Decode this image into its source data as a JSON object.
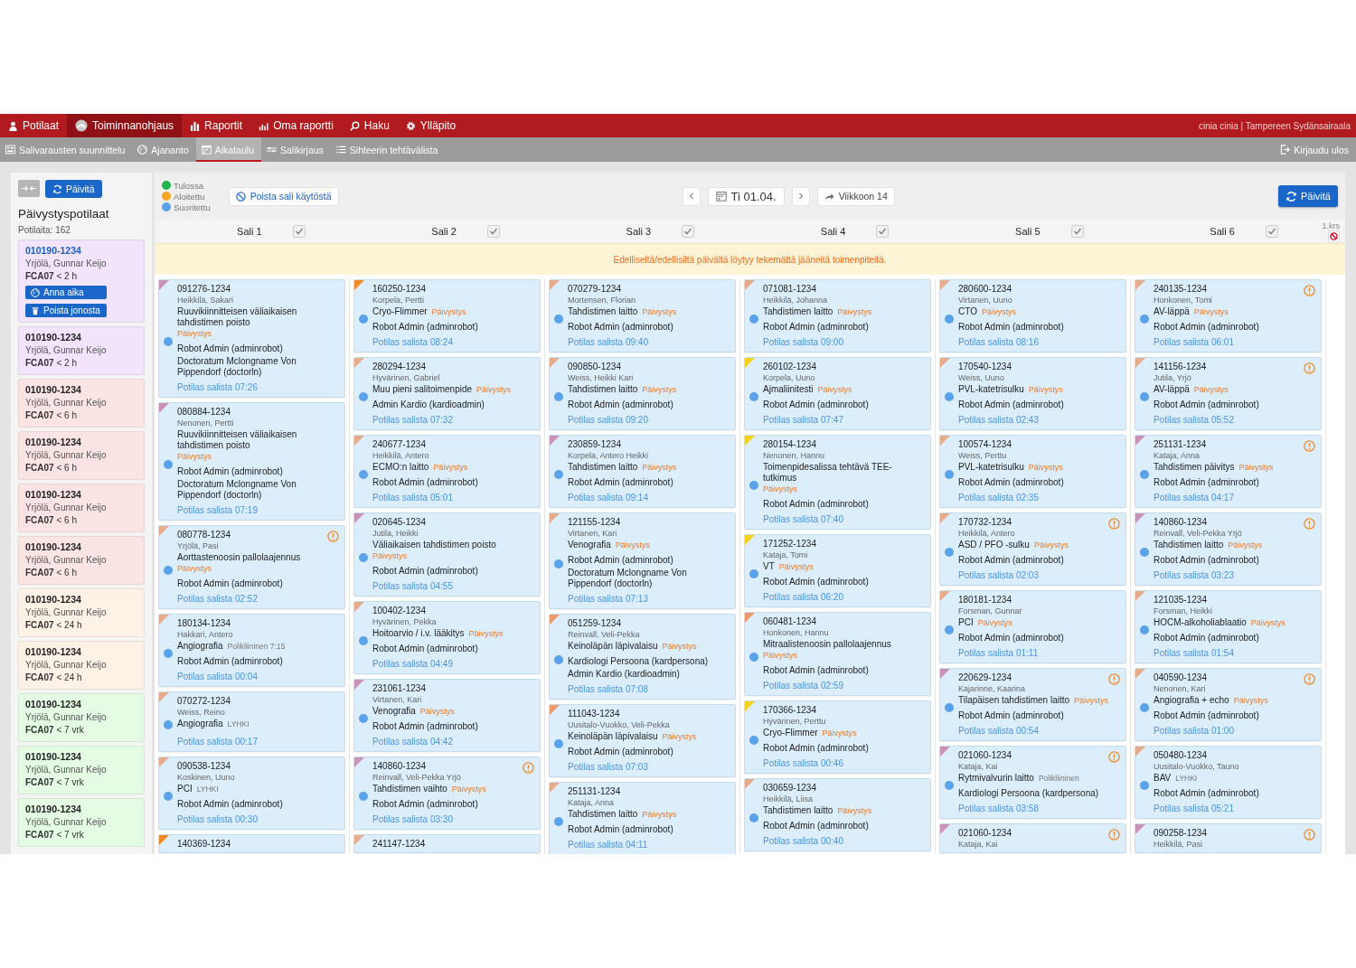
{
  "nav": {
    "items": [
      {
        "label": "Potilaat",
        "selected": false
      },
      {
        "label": "Toiminnanohjaus",
        "selected": true
      },
      {
        "label": "Raportit",
        "selected": false
      },
      {
        "label": "Oma raportti",
        "selected": false
      },
      {
        "label": "Haku",
        "selected": false
      },
      {
        "label": "Ylläpito",
        "selected": false
      }
    ],
    "user": "cinia cinia | Tampereen Sydänsairaala"
  },
  "subnav": {
    "items": [
      {
        "label": "Salivarausten suunnittelu",
        "selected": false
      },
      {
        "label": "Ajananto",
        "selected": false
      },
      {
        "label": "Aikataulu",
        "selected": true
      },
      {
        "label": "Salikirjaus",
        "selected": false
      },
      {
        "label": "Sihteerin tehtävälista",
        "selected": false
      }
    ],
    "logout": "Kirjaudu ulos"
  },
  "sidebar": {
    "refresh": "Päivitä",
    "title": "Päivystyspotilaat",
    "count": "Potilaita: 162",
    "patients": [
      {
        "id": "010190-1234",
        "name": "Yrjölä, Gunnar Keijo",
        "urgency": "**FCA07** < 2 h",
        "color": "#f1e4fc",
        "selected": true,
        "actions": [
          {
            "label": "Anna aika",
            "kind": "schedule"
          },
          {
            "label": "Poista jonosta",
            "kind": "remove"
          }
        ]
      },
      {
        "id": "010190-1234",
        "name": "Yrjölä, Gunnar Keijo",
        "urgency": "**FCA07** < 2 h",
        "color": "#f1e4fc",
        "selected": false
      },
      {
        "id": "010190-1234",
        "name": "Yrjölä, Gunnar Keijo",
        "urgency": "**FCA07** < 6 h",
        "color": "#fde4e4",
        "selected": false
      },
      {
        "id": "010190-1234",
        "name": "Yrjölä, Gunnar Keijo",
        "urgency": "**FCA07** < 6 h",
        "color": "#fde4e4",
        "selected": false
      },
      {
        "id": "010190-1234",
        "name": "Yrjölä, Gunnar Keijo",
        "urgency": "**FCA07** < 6 h",
        "color": "#fde4e4",
        "selected": false
      },
      {
        "id": "010190-1234",
        "name": "Yrjölä, Gunnar Keijo",
        "urgency": "**FCA07** < 6 h",
        "color": "#fde4e4",
        "selected": false
      },
      {
        "id": "010190-1234",
        "name": "Yrjölä, Gunnar Keijo",
        "urgency": "**FCA07** < 24 h",
        "color": "#fef1e6",
        "selected": false
      },
      {
        "id": "010190-1234",
        "name": "Yrjölä, Gunnar Keijo",
        "urgency": "**FCA07** < 24 h",
        "color": "#fef1e6",
        "selected": false
      },
      {
        "id": "010190-1234",
        "name": "Yrjölä, Gunnar Keijo",
        "urgency": "**FCA07** < 7 vrk",
        "color": "#e4fbe4",
        "selected": false
      },
      {
        "id": "010190-1234",
        "name": "Yrjölä, Gunnar Keijo",
        "urgency": "**FCA07** < 7 vrk",
        "color": "#e4fbe4",
        "selected": false
      },
      {
        "id": "010190-1234",
        "name": "Yrjölä, Gunnar Keijo",
        "urgency": "**FCA07** < 7 vrk",
        "color": "#e4fbe4",
        "selected": false
      }
    ]
  },
  "toolbar": {
    "legend": [
      {
        "label": "Tulossa",
        "color": "#22b14c"
      },
      {
        "label": "Aloitettu",
        "color": "#f5a623"
      },
      {
        "label": "Suoritettu",
        "color": "#5aa2ea"
      }
    ],
    "disable_room": "Poista sali käytöstä",
    "date": "Ti 01.04.",
    "week": "Viikkoon 14",
    "refresh": "Päivitä"
  },
  "rooms": [
    {
      "name": "Sali 1",
      "checked": true
    },
    {
      "name": "Sali 2",
      "checked": true
    },
    {
      "name": "Sali 3",
      "checked": true
    },
    {
      "name": "Sali 4",
      "checked": true
    },
    {
      "name": "Sali 5",
      "checked": true
    },
    {
      "name": "Sali 6",
      "checked": true
    }
  ],
  "floor": "1.krs",
  "notice": "Edelliseltä/edellisiltä päivältä löytyy tekemättä jääneitä toimenpiteitä.",
  "columns": [
    {
      "cards": [
        {
          "id": "091276-1234",
          "name": "Heikkilä, Sakari",
          "procedure": "Ruuvikiinnitteisen väliaikaisen tahdistimen poisto",
          "tag": {
            "text": "Päivystys",
            "kind": "urgent"
          },
          "staff": [
            "Robot Admin (adminrobot)",
            "Doctoratum Mclongname Von Pippendorf (doctorln)"
          ],
          "time": "Potilas salista 07:26",
          "color": "#c993b8",
          "warning": false
        },
        {
          "id": "080884-1234",
          "name": "Nenonen, Pertti",
          "procedure": "Ruuvikiinnitteisen väliaikaisen tahdistimen poisto",
          "tag": {
            "text": "Päivystys",
            "kind": "urgent"
          },
          "staff": [
            "Robot Admin (adminrobot)",
            "Doctoratum Mclongname Von Pippendorf (doctorln)"
          ],
          "time": "Potilas salista 07:19",
          "color": "#c993b8",
          "warning": false
        },
        {
          "id": "080778-1234",
          "name": "Yrjölä, Pasi",
          "procedure": "Aorttastenoosin pallolaajennus",
          "tag": {
            "text": "Päivystys",
            "kind": "urgent"
          },
          "staff": [
            "Robot Admin (adminrobot)"
          ],
          "time": "Potilas salista 02:52",
          "color": "#e6ad8c",
          "warning": true
        },
        {
          "id": "180134-1234",
          "name": "Hakkari, Antero",
          "procedure": "Angiografia",
          "tag": {
            "text": "Polikliininen 7:15",
            "kind": "plain"
          },
          "staff": [
            "Robot Admin (adminrobot)"
          ],
          "time": "Potilas salista 00:04",
          "color": "#e6ad8c",
          "warning": false
        },
        {
          "id": "070272-1234",
          "name": "Weiss, Reino",
          "procedure": "Angiografia",
          "tag": {
            "text": "LYHKI",
            "kind": "plain"
          },
          "time": "Potilas salista 00:17",
          "color": "#e6ad8c",
          "warning": false
        },
        {
          "id": "090538-1234",
          "name": "Koskinen, Uuno",
          "procedure": "PCI",
          "tag": {
            "text": "LYHKI",
            "kind": "plain"
          },
          "staff": [
            "Robot Admin (adminrobot)"
          ],
          "time": "Potilas salista 00:30",
          "color": "#e6ad8c",
          "warning": false
        },
        {
          "id": "140369-1234",
          "color": "#f08a24",
          "warning": false
        }
      ]
    },
    {
      "cards": [
        {
          "id": "160250-1234",
          "name": "Korpela, Pertti",
          "procedure": "Cryo-Flimmer",
          "tag": {
            "text": "Päivystys",
            "kind": "urgent"
          },
          "staff": [
            "Robot Admin (adminrobot)"
          ],
          "time": "Potilas salista 08:24",
          "color": "#f08a24",
          "warning": false
        },
        {
          "id": "280294-1234",
          "name": "Hyvärinen, Gabriel",
          "procedure": "Muu pieni salitoimenpide",
          "tag": {
            "text": "Päivystys",
            "kind": "urgent"
          },
          "staff": [
            "Admin Kardio (kardioadmin)"
          ],
          "time": "Potilas salista 07:32",
          "color": "#e6ad8c",
          "warning": false
        },
        {
          "id": "240677-1234",
          "name": "Heikkilä, Antero",
          "procedure": "ECMO:n laitto",
          "tag": {
            "text": "Päivystys",
            "kind": "urgent"
          },
          "staff": [
            "Robot Admin (adminrobot)"
          ],
          "time": "Potilas salista 05:01",
          "color": "#e6ad8c",
          "warning": false
        },
        {
          "id": "020645-1234",
          "name": "Jutila, Heikki",
          "procedure": "Väliaikaisen tahdistimen poisto",
          "tag": {
            "text": "Päivystys",
            "kind": "urgent"
          },
          "staff": [
            "Robot Admin (adminrobot)"
          ],
          "time": "Potilas salista 04:55",
          "color": "#c993b8",
          "warning": false
        },
        {
          "id": "100402-1234",
          "name": "Hyvärinen, Pekka",
          "procedure": "Hoitoarvio / i.v. lääkitys",
          "tag": {
            "text": "Päivystys",
            "kind": "urgent"
          },
          "staff": [
            "Robot Admin (adminrobot)"
          ],
          "time": "Potilas salista 04:49",
          "color": "#e6ad8c",
          "warning": false
        },
        {
          "id": "231061-1234",
          "name": "Virtanen, Kari",
          "procedure": "Venografia",
          "tag": {
            "text": "Päivystys",
            "kind": "urgent"
          },
          "staff": [
            "Robot Admin (adminrobot)"
          ],
          "time": "Potilas salista 04:42",
          "color": "#c993b8",
          "warning": false
        },
        {
          "id": "140860-1234",
          "name": "Reinvall, Veli-Pekka Yrjö",
          "procedure": "Tahdistimen vaihto",
          "tag": {
            "text": "Päivystys",
            "kind": "urgent"
          },
          "staff": [
            "Robot Admin (adminrobot)"
          ],
          "time": "Potilas salista 03:30",
          "color": "#c993b8",
          "warning": true
        },
        {
          "id": "241147-1234",
          "color": "#e6ad8c",
          "warning": false
        }
      ]
    },
    {
      "cards": [
        {
          "id": "070279-1234",
          "name": "Mortensen, Florian",
          "procedure": "Tahdistimen laitto",
          "tag": {
            "text": "Päivystys",
            "kind": "urgent"
          },
          "staff": [
            "Robot Admin (adminrobot)"
          ],
          "time": "Potilas salista 09:40",
          "color": "#e6ad8c",
          "warning": false
        },
        {
          "id": "090850-1234",
          "name": "Weiss, Heikki Kari",
          "procedure": "Tahdistimen laitto",
          "tag": {
            "text": "Päivystys",
            "kind": "urgent"
          },
          "staff": [
            "Robot Admin (adminrobot)"
          ],
          "time": "Potilas salista 09:20",
          "color": "#e6ad8c",
          "warning": false
        },
        {
          "id": "230859-1234",
          "name": "Korpela, Antero Heikki",
          "procedure": "Tahdistimen laitto",
          "tag": {
            "text": "Päivystys",
            "kind": "urgent"
          },
          "staff": [
            "Robot Admin (adminrobot)"
          ],
          "time": "Potilas salista 09:14",
          "color": "#c993b8",
          "warning": false
        },
        {
          "id": "121155-1234",
          "name": "Virtanen, Kari",
          "procedure": "Venografia",
          "tag": {
            "text": "Päivystys",
            "kind": "urgent"
          },
          "staff": [
            "Robot Admin (adminrobot)",
            "Doctoratum Mclongname Von Pippendorf (doctorln)"
          ],
          "time": "Potilas salista 07:13",
          "color": "#e6ad8c",
          "warning": false
        },
        {
          "id": "051259-1234",
          "name": "Reinvall, Veli-Pekka",
          "procedure": "Keinoläpän läpivalaisu",
          "tag": {
            "text": "Päivystys",
            "kind": "urgent"
          },
          "staff": [
            "Kardiologi Persoona (kardpersona)",
            "Admin Kardio (kardioadmin)"
          ],
          "time": "Potilas salista 07:08",
          "color": "#ec9a6c",
          "warning": false
        },
        {
          "id": "111043-1234",
          "name": "Uusitalo-Vuokko, Veli-Pekka",
          "procedure": "Keinoläpän läpivalaisu",
          "tag": {
            "text": "Päivystys",
            "kind": "urgent"
          },
          "staff": [
            "Robot Admin (adminrobot)"
          ],
          "time": "Potilas salista 07:03",
          "color": "#ec9a6c",
          "warning": false
        },
        {
          "id": "251131-1234",
          "name": "Kataja, Anna",
          "procedure": "Tahdistimen laitto",
          "tag": {
            "text": "Päivystys",
            "kind": "urgent"
          },
          "staff": [
            "Robot Admin (adminrobot)"
          ],
          "time": "Potilas salista 04:11",
          "color": "#e6ad8c",
          "warning": false
        }
      ]
    },
    {
      "cards": [
        {
          "id": "071081-1234",
          "name": "Heikkilä, Johanna",
          "procedure": "Tahdistimen laitto",
          "tag": {
            "text": "Päivystys",
            "kind": "urgent"
          },
          "staff": [
            "Robot Admin (adminrobot)"
          ],
          "time": "Potilas salista 09:00",
          "color": "#e6ad8c",
          "warning": false
        },
        {
          "id": "260102-1234",
          "name": "Korpela, Uuno",
          "procedure": "Ajmaliinitesti",
          "tag": {
            "text": "Päivystys",
            "kind": "urgent"
          },
          "staff": [
            "Robot Admin (adminrobot)"
          ],
          "time": "Potilas salista 07:47",
          "color": "#f3d21c",
          "warning": false
        },
        {
          "id": "280154-1234",
          "name": "Nenonen, Hannu",
          "procedure": "Toimenpidesalissa tehtävä TEE-tutkimus",
          "tag": {
            "text": "Päivystys",
            "kind": "urgent"
          },
          "staff": [
            "Robot Admin (adminrobot)"
          ],
          "time": "Potilas salista 07:40",
          "color": "#f3d21c",
          "warning": false
        },
        {
          "id": "171252-1234",
          "name": "Kataja, Tomi",
          "procedure": "VT",
          "tag": {
            "text": "Päivystys",
            "kind": "urgent"
          },
          "staff": [
            "Robot Admin (adminrobot)"
          ],
          "time": "Potilas salista 06:20",
          "color": "#f3d21c",
          "warning": false
        },
        {
          "id": "060481-1234",
          "name": "Honkonen, Hannu",
          "procedure": "Mitraalistenoosin pallolaajennus",
          "tag": {
            "text": "Päivystys",
            "kind": "urgent"
          },
          "staff": [
            "Robot Admin (adminrobot)"
          ],
          "time": "Potilas salista 02:59",
          "color": "#ec9a6c",
          "warning": false
        },
        {
          "id": "170366-1234",
          "name": "Hyvärinen, Perttu",
          "procedure": "Cryo-Flimmer",
          "tag": {
            "text": "Päivystys",
            "kind": "urgent"
          },
          "staff": [
            "Robot Admin (adminrobot)"
          ],
          "time": "Potilas salista 00:46",
          "color": "#f3d21c",
          "warning": false
        },
        {
          "id": "030659-1234",
          "name": "Heikkilä, Liisa",
          "procedure": "Tahdistimen laitto",
          "tag": {
            "text": "Päivystys",
            "kind": "urgent"
          },
          "staff": [
            "Robot Admin (adminrobot)"
          ],
          "time": "Potilas salista 00:40",
          "color": "#e6ad8c",
          "warning": false
        }
      ]
    },
    {
      "cards": [
        {
          "id": "280600-1234",
          "name": "Virtanen, Uuno",
          "procedure": "CTO",
          "tag": {
            "text": "Päivystys",
            "kind": "urgent"
          },
          "staff": [
            "Robot Admin (adminrobot)"
          ],
          "time": "Potilas salista 08:16",
          "color": "#e6ad8c",
          "warning": false
        },
        {
          "id": "170540-1234",
          "name": "Weiss, Uuno",
          "procedure": "PVL-katetrisulku",
          "tag": {
            "text": "Päivystys",
            "kind": "urgent"
          },
          "staff": [
            "Robot Admin (adminrobot)"
          ],
          "time": "Potilas salista 02:43",
          "color": "#e6ad8c",
          "warning": false
        },
        {
          "id": "100574-1234",
          "name": "Weiss, Perttu",
          "procedure": "PVL-katetrisulku",
          "tag": {
            "text": "Päivystys",
            "kind": "urgent"
          },
          "staff": [
            "Robot Admin (adminrobot)"
          ],
          "time": "Potilas salista 02:35",
          "color": "#e6ad8c",
          "warning": false
        },
        {
          "id": "170732-1234",
          "name": "Heikkilä, Antero",
          "procedure": "ASD / PFO -sulku",
          "tag": {
            "text": "Päivystys",
            "kind": "urgent"
          },
          "staff": [
            "Robot Admin (adminrobot)"
          ],
          "time": "Potilas salista 02:03",
          "color": "#e6ad8c",
          "warning": true
        },
        {
          "id": "180181-1234",
          "name": "Forsman, Gunnar",
          "procedure": "PCI",
          "tag": {
            "text": "Päivystys",
            "kind": "urgent"
          },
          "staff": [
            "Robot Admin (adminrobot)"
          ],
          "time": "Potilas salista 01:11",
          "color": "#e6ad8c",
          "warning": false
        },
        {
          "id": "220629-1234",
          "name": "Kajarinne, Kaarina",
          "procedure": "Tilapäisen tahdistimen laitto",
          "tag": {
            "text": "Päivystys",
            "kind": "urgent"
          },
          "staff": [
            "Robot Admin (adminrobot)"
          ],
          "time": "Potilas salista 00:54",
          "color": "#c993b8",
          "warning": true
        },
        {
          "id": "021060-1234",
          "name": "Kataja, Kai",
          "procedure": "Rytmivalvurin laitto",
          "tag": {
            "text": "Polikliininen",
            "kind": "plain"
          },
          "staff": [
            "Kardiologi Persoona (kardpersona)"
          ],
          "time": "Potilas salista 03:58",
          "color": "#c993b8",
          "warning": true
        },
        {
          "id": "021060-1234",
          "name": "Kataja, Kai",
          "color": "#c993b8",
          "warning": true
        }
      ]
    },
    {
      "cards": [
        {
          "id": "240135-1234",
          "name": "Honkonen, Tomi",
          "procedure": "AV-läppä",
          "tag": {
            "text": "Päivystys",
            "kind": "urgent"
          },
          "staff": [
            "Robot Admin (adminrobot)"
          ],
          "time": "Potilas salista 06:01",
          "color": "#e6ad8c",
          "warning": true
        },
        {
          "id": "141156-1234",
          "name": "Jutila, Yrjö",
          "procedure": "AV-läppä",
          "tag": {
            "text": "Päivystys",
            "kind": "urgent"
          },
          "staff": [
            "Robot Admin (adminrobot)"
          ],
          "time": "Potilas salista 05:52",
          "color": "#e6ad8c",
          "warning": true
        },
        {
          "id": "251131-1234",
          "name": "Kataja, Anna",
          "procedure": "Tahdistimen päivitys",
          "tag": {
            "text": "Päivystys",
            "kind": "urgent"
          },
          "staff": [
            "Robot Admin (adminrobot)"
          ],
          "time": "Potilas salista 04:17",
          "color": "#c993b8",
          "warning": true
        },
        {
          "id": "140860-1234",
          "name": "Reinvall, Veli-Pekka Yrjö",
          "procedure": "Tahdistimen laitto",
          "tag": {
            "text": "Päivystys",
            "kind": "urgent"
          },
          "staff": [
            "Robot Admin (adminrobot)"
          ],
          "time": "Potilas salista 03:23",
          "color": "#c993b8",
          "warning": true
        },
        {
          "id": "121035-1234",
          "name": "Forsman, Heikki",
          "procedure": "HOCM-alkoholiablaatio",
          "tag": {
            "text": "Päivystys",
            "kind": "urgent"
          },
          "staff": [
            "Robot Admin (adminrobot)"
          ],
          "time": "Potilas salista 01:54",
          "color": "#e6ad8c",
          "warning": false
        },
        {
          "id": "040590-1234",
          "name": "Nenonen, Kari",
          "procedure": "Angiografia + echo",
          "tag": {
            "text": "Päivystys",
            "kind": "urgent"
          },
          "staff": [
            "Robot Admin (adminrobot)"
          ],
          "time": "Potilas salista 01:00",
          "color": "#e6ad8c",
          "warning": true
        },
        {
          "id": "050480-1234",
          "name": "Uusitalo-Vuokko, Tauno",
          "procedure": "BAV",
          "tag": {
            "text": "LYHKI",
            "kind": "plain"
          },
          "staff": [
            "Robot Admin (adminrobot)"
          ],
          "time": "Potilas salista 05:21",
          "color": "#e6ad8c",
          "warning": false
        },
        {
          "id": "090258-1234",
          "name": "Heikkilä, Pasi",
          "color": "#c993b8",
          "warning": true
        }
      ]
    }
  ]
}
